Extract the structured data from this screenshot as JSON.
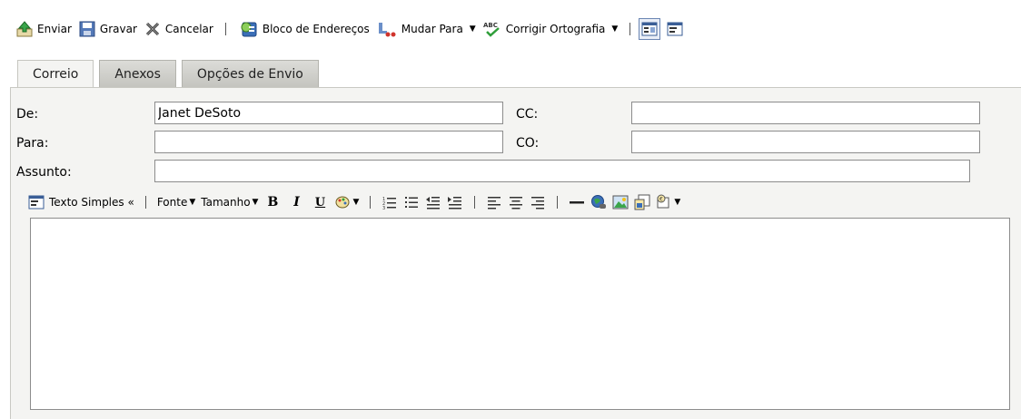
{
  "toolbar": {
    "send": "Enviar",
    "save": "Gravar",
    "cancel": "Cancelar",
    "address_book": "Bloco de Endereços",
    "change_to": "Mudar Para",
    "spell_check": "Corrigir Ortografia"
  },
  "tabs": [
    {
      "label": "Correio",
      "active": true
    },
    {
      "label": "Anexos",
      "active": false
    },
    {
      "label": "Opções de Envio",
      "active": false
    }
  ],
  "form": {
    "from_label": "De:",
    "from_value": "Janet DeSoto",
    "to_label": "Para:",
    "to_value": "",
    "subject_label": "Assunto:",
    "subject_value": "",
    "cc_label": "CC:",
    "cc_value": "",
    "bcc_label": "CO:",
    "bcc_value": ""
  },
  "editor_toolbar": {
    "plain_text": "Texto Simples «",
    "font": "Fonte",
    "size": "Tamanho",
    "bold": "B",
    "italic": "I",
    "underline": "U"
  },
  "colors": {
    "panel_bg": "#f4f4f2",
    "tab_inactive": "#c4c4bf",
    "border": "#8c8c8c"
  }
}
